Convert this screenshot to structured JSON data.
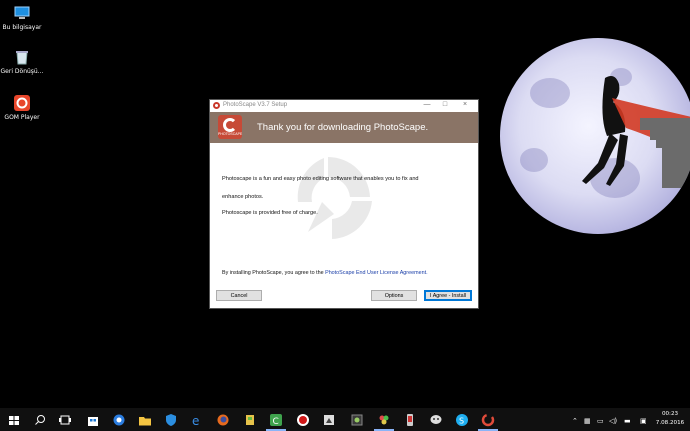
{
  "desktop": {
    "icons": [
      {
        "label": "Bu bilgisayar"
      },
      {
        "label": "Geri Dönüşü..."
      },
      {
        "label": "GOM Player"
      }
    ]
  },
  "dialog": {
    "title": "PhotoScape V3.7 Setup",
    "banner_heading": "Thank you for downloading PhotoScape.",
    "logo_caption": "PHOTOSCAPE",
    "para1_line1": "Photoscape is a fun and easy photo editing software that enables you to fix and",
    "para1_line2": "enhance photos.",
    "para2": "Photoscape is provided free of charge.",
    "agree_prefix": "By installing PhotoScape, you agree to the",
    "agree_link": "PhotoScape End User License Agreement.",
    "buttons": {
      "cancel": "Cancel",
      "options": "Options",
      "install": "I Agree - Install"
    },
    "window_controls": {
      "minimize": "—",
      "maximize": "□",
      "close": "×"
    }
  },
  "taskbar": {
    "apps": [
      "start",
      "search",
      "task-view",
      "store",
      "edge-alt",
      "file-explorer",
      "shield",
      "edge",
      "firefox",
      "paint",
      "camtasia",
      "notepad",
      "record",
      "media",
      "game",
      "flower",
      "phone",
      "chat",
      "skype",
      "photoscape"
    ],
    "tray": {
      "time": "00:23",
      "date": "7.08.2016"
    }
  }
}
